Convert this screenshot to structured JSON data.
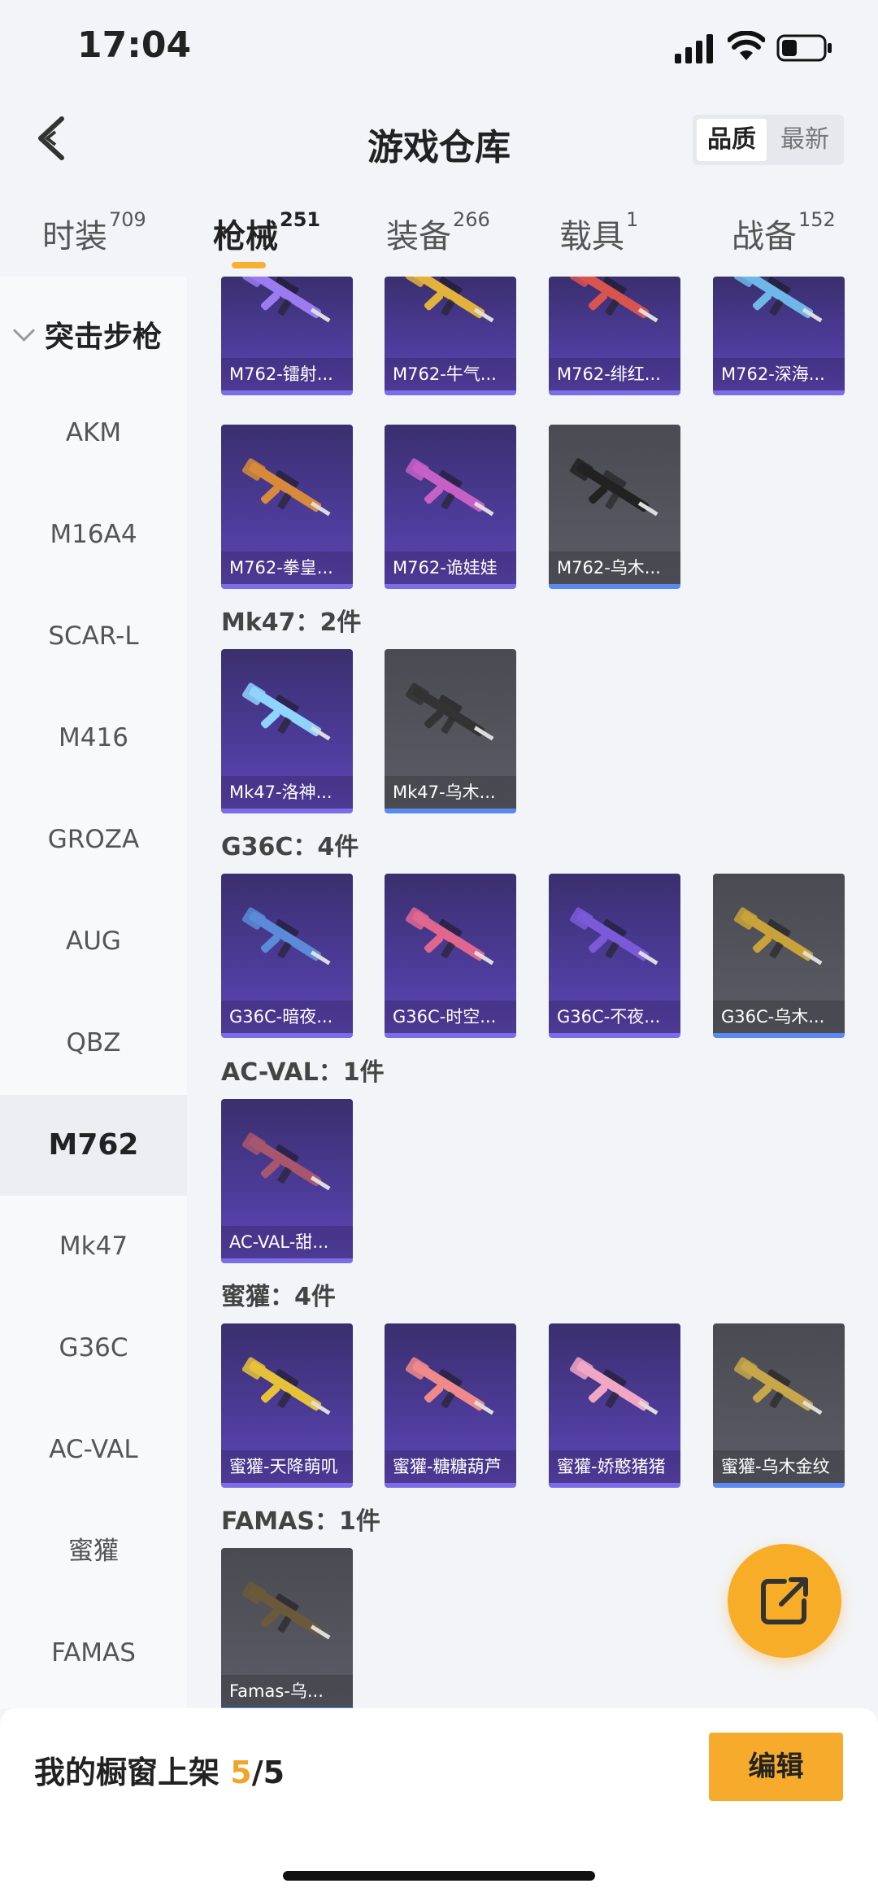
{
  "status": {
    "time": "17:04"
  },
  "header": {
    "title": "游戏仓库",
    "sort_quality": "品质",
    "sort_newest": "最新"
  },
  "tabs": [
    {
      "label": "时装",
      "count": "709"
    },
    {
      "label": "枪械",
      "count": "251"
    },
    {
      "label": "装备",
      "count": "266"
    },
    {
      "label": "载具",
      "count": "1"
    },
    {
      "label": "战备",
      "count": "152"
    }
  ],
  "sidebar": {
    "category": "突击步枪",
    "items": [
      "AKM",
      "M16A4",
      "SCAR-L",
      "M416",
      "GROZA",
      "AUG",
      "QBZ",
      "M762",
      "Mk47",
      "G36C",
      "AC-VAL",
      "蜜獾",
      "FAMAS"
    ]
  },
  "groups": [
    {
      "title": "",
      "items": [
        "M762-镭射...",
        "M762-牛气...",
        "M762-绯红...",
        "M762-深海...",
        "M762-拳皇...",
        "M762-诡娃娃",
        "M762-乌木..."
      ]
    },
    {
      "title": "Mk47：2件",
      "items": [
        "Mk47-洛神...",
        "Mk47-乌木..."
      ]
    },
    {
      "title": "G36C：4件",
      "items": [
        "G36C-暗夜...",
        "G36C-时空...",
        "G36C-不夜...",
        "G36C-乌木..."
      ]
    },
    {
      "title": "AC-VAL：1件",
      "items": [
        "AC-VAL-甜..."
      ]
    },
    {
      "title": "蜜獾：4件",
      "items": [
        "蜜獾-天降萌叽",
        "蜜獾-糖糖葫芦",
        "蜜獾-娇憨猪猪",
        "蜜獾-乌木金纹"
      ]
    },
    {
      "title": "FAMAS：1件",
      "items": [
        "Famas-乌..."
      ]
    }
  ],
  "footer": {
    "shelf_label": "我的橱窗上架",
    "shelf_used": "5",
    "shelf_total": "/5",
    "edit_label": "编辑"
  },
  "colors": {
    "accent": "#f7ab2d",
    "card_purple": "#4d3c9a",
    "card_gray": "#55555e"
  },
  "icons": {
    "back": "chevron-left-icon",
    "fab": "share-external-icon"
  }
}
